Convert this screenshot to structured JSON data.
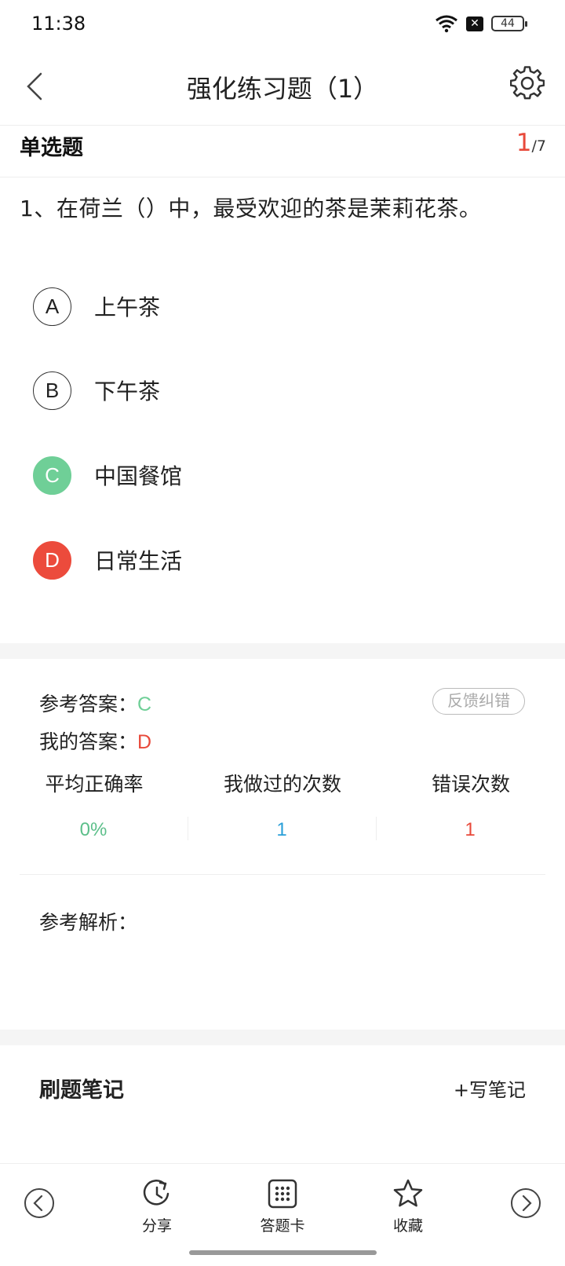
{
  "status_bar": {
    "time": "11:38",
    "battery": "44",
    "notif_glyph": "✕"
  },
  "header": {
    "title": "强化练习题（1）"
  },
  "question": {
    "type_label": "单选题",
    "current": "1",
    "total": "/7",
    "text": "1、在荷兰（）中，最受欢迎的茶是茉莉花茶。"
  },
  "options": [
    {
      "letter": "A",
      "text": "上午茶",
      "state": "normal"
    },
    {
      "letter": "B",
      "text": "下午茶",
      "state": "normal"
    },
    {
      "letter": "C",
      "text": "中国餐馆",
      "state": "correct"
    },
    {
      "letter": "D",
      "text": "日常生活",
      "state": "wrong"
    }
  ],
  "answer": {
    "reference_label": "参考答案：",
    "reference_value": "C",
    "mine_label": "我的答案：",
    "mine_value": "D",
    "feedback_label": "反馈纠错"
  },
  "stats": {
    "labels": [
      "平均正确率",
      "我做过的次数",
      "错误次数"
    ],
    "values": [
      "0%",
      "1",
      "1"
    ],
    "colors": [
      "#5cbf8a",
      "#2a9fd8",
      "#e8493a"
    ]
  },
  "analysis": {
    "label": "参考解析："
  },
  "notes": {
    "title": "刷题笔记",
    "write_label": "+写笔记"
  },
  "bottom_bar": {
    "share_label": "分享",
    "card_label": "答题卡",
    "fav_label": "收藏"
  },
  "colors": {
    "correct": "#6fcf97",
    "wrong": "#ec4b3c",
    "accent_red": "#e8493a"
  }
}
